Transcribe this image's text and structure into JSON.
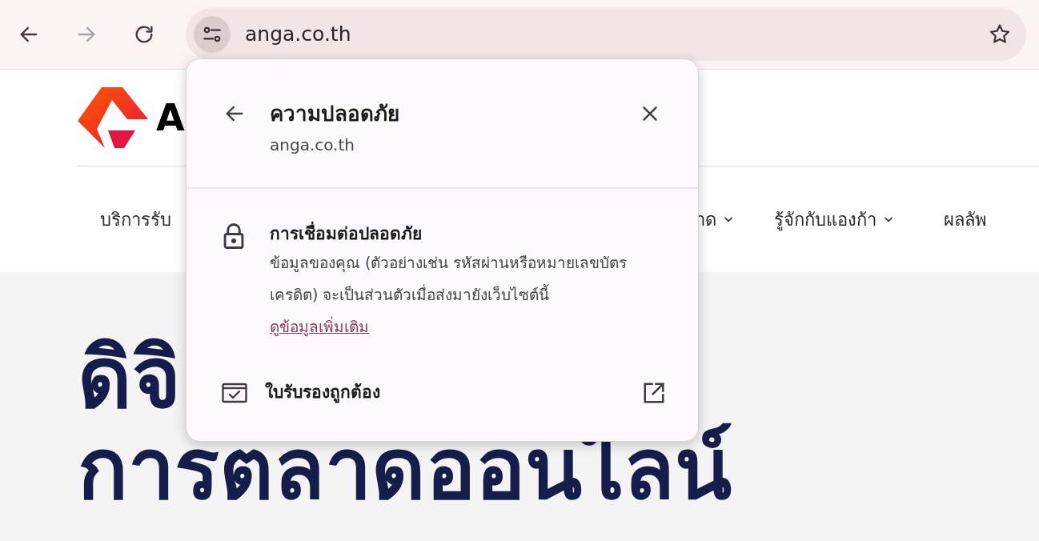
{
  "toolbar": {
    "url": "anga.co.th",
    "buttons": [
      {
        "kind": "back",
        "disabled": false
      },
      {
        "kind": "forward",
        "disabled": true
      },
      {
        "kind": "reload",
        "disabled": false
      }
    ]
  },
  "page": {
    "logo_text": "A",
    "nav": [
      {
        "label": "บริการรับ",
        "has_caret": false
      },
      {
        "label": "าด",
        "has_caret": true
      },
      {
        "label": "รู้จักกับแองก้า",
        "has_caret": true
      },
      {
        "label": "ผลลัพ",
        "has_caret": false
      }
    ],
    "headline": [
      "ดิจิ",
      "การตลาดออนไลน์"
    ]
  },
  "popup": {
    "title": "ความปลอดภัย",
    "subtitle": "anga.co.th",
    "connection": {
      "title": "การเชื่อมต่อปลอดภัย",
      "text": "ข้อมูลของคุณ (ตัวอย่างเช่น รหัสผ่านหรือหมายเลขบัตรเครดิต) จะเป็นส่วนตัวเมื่อส่งมายังเว็บไซต์นี้",
      "link": "ดูข้อมูลเพิ่มเติม"
    },
    "certificate": {
      "label": "ใบรับรองถูกต้อง"
    }
  }
}
